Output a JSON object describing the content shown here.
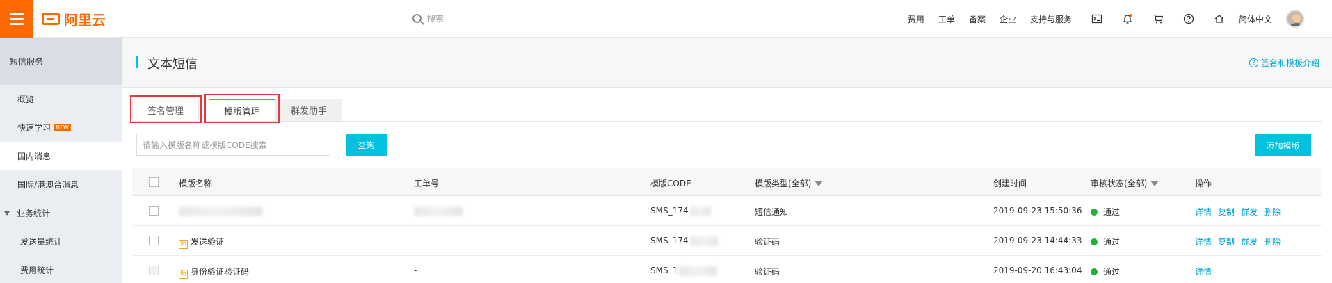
{
  "topbar": {
    "logo_text": "阿里云",
    "search_placeholder": "搜索",
    "nav": [
      "费用",
      "工单",
      "备案",
      "企业",
      "支持与服务"
    ],
    "language": "简体中文",
    "icons": [
      "terminal-icon",
      "bell-icon",
      "cart-icon",
      "help-icon",
      "home-icon"
    ]
  },
  "sidebar": {
    "title": "短信服务",
    "items": [
      {
        "label": "概览"
      },
      {
        "label": "快速学习",
        "badge": "NEW"
      },
      {
        "label": "国内消息"
      },
      {
        "label": "国际/港澳台消息"
      },
      {
        "label": "业务统计"
      },
      {
        "label": "发送量统计"
      },
      {
        "label": "费用统计"
      }
    ]
  },
  "page": {
    "title": "文本短信",
    "help_link": "签名和模板介绍"
  },
  "tabs": [
    "签名管理",
    "模版管理",
    "群发助手"
  ],
  "filter": {
    "placeholder": "请输入模版名称或模版CODE搜索",
    "query_button": "查询",
    "add_button": "添加模版"
  },
  "table": {
    "headers": {
      "name": "模版名称",
      "ticket": "工单号",
      "code": "模版CODE",
      "type": "模版类型(全部)",
      "created": "创建时间",
      "status": "审核状态(全部)",
      "ops": "操作"
    },
    "rows": [
      {
        "tag": "",
        "name": "",
        "ticket": "",
        "code": "SMS_174",
        "type": "短信通知",
        "created": "2019-09-23 15:50:36",
        "status": "通过",
        "ops": [
          "详情",
          "复制",
          "群发",
          "删除"
        ]
      },
      {
        "tag": "新",
        "name": "发送验证",
        "ticket": "-",
        "code": "SMS_174",
        "type": "验证码",
        "created": "2019-09-23 14:44:33",
        "status": "通过",
        "ops": [
          "详情",
          "复制",
          "群发",
          "删除"
        ]
      },
      {
        "tag": "新",
        "name": "身份验证验证码",
        "ticket": "-",
        "code": "SMS_1",
        "type": "验证码",
        "created": "2019-09-20 16:43:04",
        "status": "通过",
        "ops": [
          "详情"
        ]
      }
    ]
  },
  "colors": {
    "brand": "#ff6a00",
    "accent": "#00c1de",
    "link": "#00a2ca",
    "success": "#1fb13b",
    "highlight_box": "#e4393c"
  }
}
